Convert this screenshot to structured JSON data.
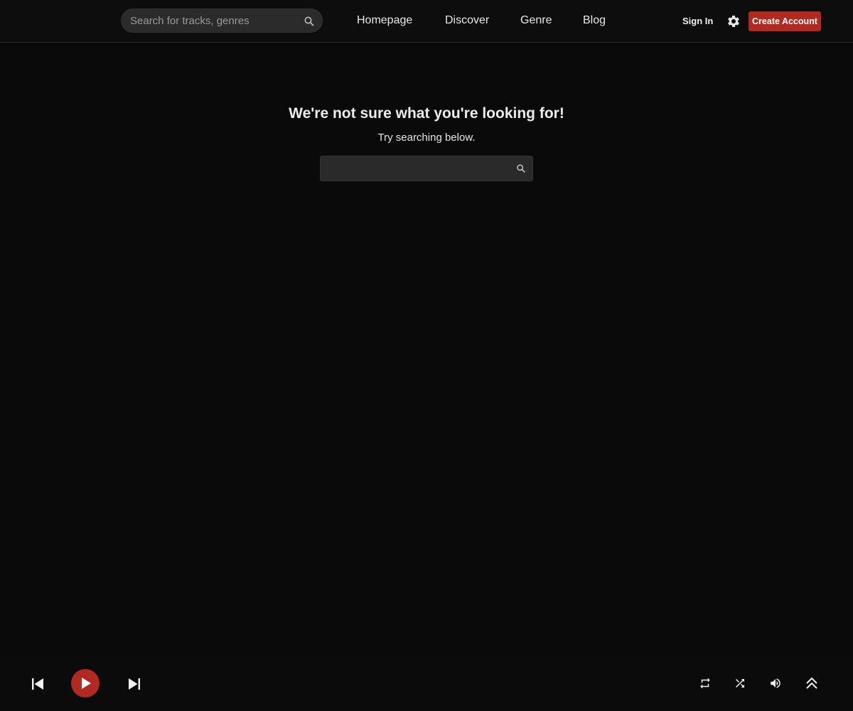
{
  "header": {
    "search": {
      "placeholder": "Search for tracks, genres",
      "icon": "search-icon"
    },
    "nav": [
      {
        "label": "Homepage"
      },
      {
        "label": "Discover"
      },
      {
        "label": "Genre"
      },
      {
        "label": "Blog"
      }
    ],
    "signin_label": "Sign In",
    "settings_icon": "gear-icon",
    "create_account_label": "Create Account"
  },
  "main": {
    "title": "We're not sure what you're looking for!",
    "subtitle": "Try searching below.",
    "search": {
      "value": "",
      "icon": "search-icon"
    }
  },
  "player": {
    "controls": [
      "previous-icon",
      "play-icon",
      "next-icon"
    ],
    "right_controls": [
      "repeat-icon",
      "shuffle-icon",
      "volume-icon",
      "expand-icon"
    ]
  },
  "colors": {
    "accent": "#b02a21",
    "background": "#0a0a0a",
    "field": "#2b2b2b"
  }
}
